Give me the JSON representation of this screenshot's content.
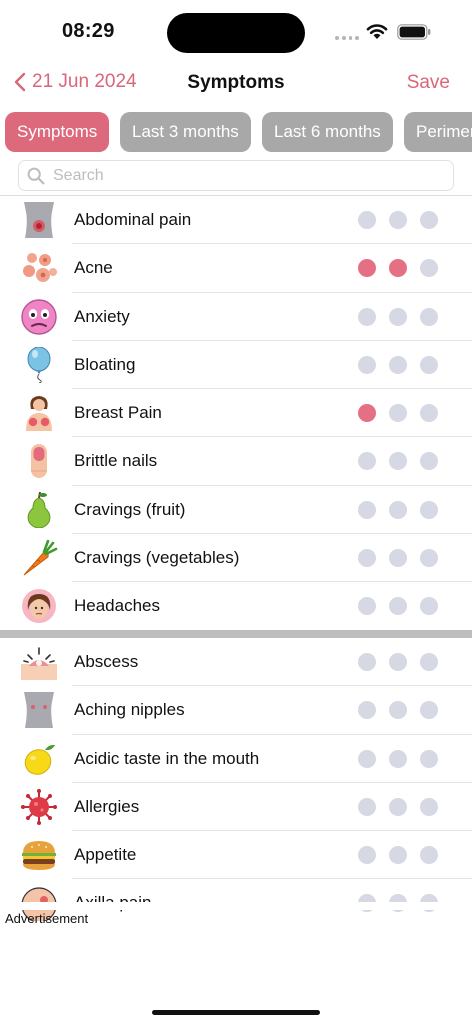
{
  "status_bar": {
    "time": "08:29"
  },
  "nav": {
    "back_label": "21 Jun 2024",
    "title": "Symptoms",
    "save_label": "Save",
    "accent_color": "#d9667a"
  },
  "tabs": [
    {
      "label": "Symptoms",
      "active": true
    },
    {
      "label": "Last 3 months",
      "active": false
    },
    {
      "label": "Last 6 months",
      "active": false
    },
    {
      "label": "Perimen",
      "active": false
    }
  ],
  "search": {
    "placeholder": "Search",
    "value": ""
  },
  "section_a": [
    {
      "icon": "abdomen-icon",
      "label": "Abdominal pain",
      "level": 0
    },
    {
      "icon": "acne-icon",
      "label": "Acne",
      "level": 2
    },
    {
      "icon": "anxious-face-icon",
      "label": "Anxiety",
      "level": 0
    },
    {
      "icon": "balloon-icon",
      "label": "Bloating",
      "level": 0
    },
    {
      "icon": "breast-icon",
      "label": "Breast Pain",
      "level": 1
    },
    {
      "icon": "finger-nail-icon",
      "label": "Brittle nails",
      "level": 0
    },
    {
      "icon": "pear-icon",
      "label": "Cravings (fruit)",
      "level": 0
    },
    {
      "icon": "carrot-icon",
      "label": "Cravings (vegetables)",
      "level": 0
    },
    {
      "icon": "headache-face-icon",
      "label": "Headaches",
      "level": 0
    }
  ],
  "section_b": [
    {
      "icon": "abscess-icon",
      "label": "Abscess",
      "level": 0
    },
    {
      "icon": "torso-icon",
      "label": "Aching nipples",
      "level": 0
    },
    {
      "icon": "lemon-icon",
      "label": "Acidic taste in the mouth",
      "level": 0
    },
    {
      "icon": "virus-icon",
      "label": "Allergies",
      "level": 0
    },
    {
      "icon": "burger-icon",
      "label": "Appetite",
      "level": 0
    },
    {
      "icon": "armpit-icon",
      "label": "Axilla pain",
      "level": 0
    }
  ],
  "dot_colors": {
    "on": "#e57083",
    "off": "#d6d8e3"
  },
  "footer": {
    "ad_label": "Advertisement"
  }
}
